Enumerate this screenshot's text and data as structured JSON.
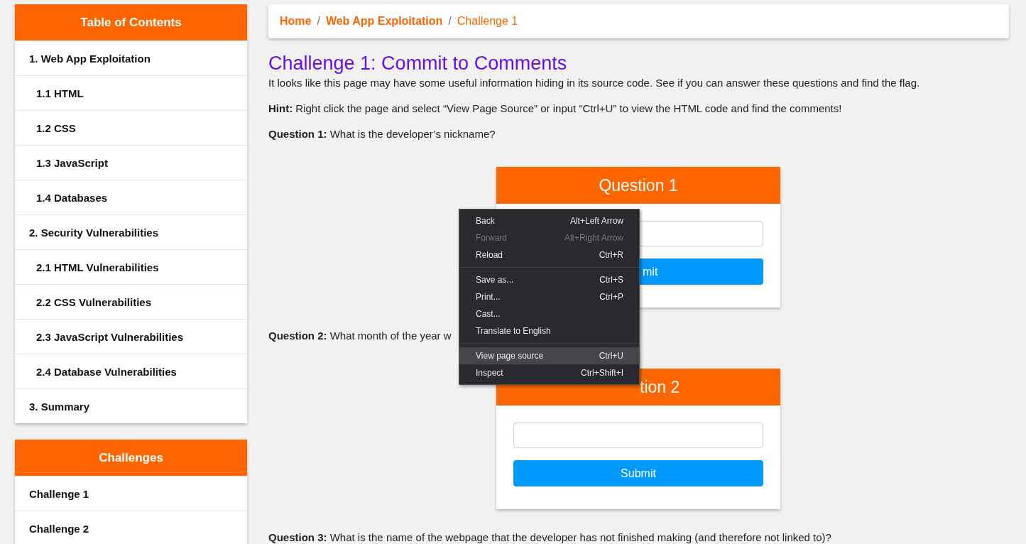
{
  "toc": {
    "title": "Table of Contents",
    "items": [
      {
        "label": "1. Web App Exploitation",
        "children": [
          {
            "label": "1.1 HTML"
          },
          {
            "label": "1.2 CSS"
          },
          {
            "label": "1.3 JavaScript"
          },
          {
            "label": "1.4 Databases"
          }
        ]
      },
      {
        "label": "2. Security Vulnerabilities",
        "children": [
          {
            "label": "2.1 HTML Vulnerabilities"
          },
          {
            "label": "2.2 CSS Vulnerabilities"
          },
          {
            "label": "2.3 JavaScript Vulnerabilities"
          },
          {
            "label": "2.4 Database Vulnerabilities"
          }
        ]
      },
      {
        "label": "3. Summary"
      }
    ]
  },
  "challenges": {
    "title": "Challenges",
    "items": [
      {
        "label": "Challenge 1"
      },
      {
        "label": "Challenge 2"
      }
    ]
  },
  "breadcrumb": [
    {
      "label": "Home",
      "kind": "link"
    },
    {
      "label": "/",
      "kind": "separator"
    },
    {
      "label": "Web App Exploitation",
      "kind": "link"
    },
    {
      "label": "/",
      "kind": "separator"
    },
    {
      "label": "Challenge 1",
      "kind": "current"
    }
  ],
  "heading": "Challenge 1: Commit to Comments",
  "intro": "It looks like this page may have some useful information hiding in its source code. See if you can answer these questions and find the flag.",
  "hint": "**Hint:** Right click the page and select “View Page Source” or input “Ctrl+U” to view the HTML code and find the comments!",
  "questions": [
    {
      "prompt": "**Question 1:** What is the developer’s nickname?",
      "card": {
        "title": "Question 1",
        "title_cut_left": false,
        "button": "mit",
        "button_cut_left": true
      }
    },
    {
      "prompt": "**Question 2:** What month of the year w",
      "card": {
        "title": "tion 2",
        "title_cut_left": true,
        "button": "Submit",
        "button_cut_left": false
      }
    },
    {
      "prompt": "**Question 3:** What is the name of the webpage that the developer has not finished making (and therefore not linked to)?"
    }
  ],
  "context_menu": [
    {
      "kind": "item",
      "label": "Back",
      "shortcut": "Alt+Left Arrow",
      "disabled": false,
      "selected": false
    },
    {
      "kind": "item",
      "label": "Forward",
      "shortcut": "Alt+Right Arrow",
      "disabled": true,
      "selected": false
    },
    {
      "kind": "item",
      "label": "Reload",
      "shortcut": "Ctrl+R",
      "disabled": false,
      "selected": false
    },
    {
      "kind": "separator"
    },
    {
      "kind": "item",
      "label": "Save as...",
      "shortcut": "Ctrl+S",
      "disabled": false,
      "selected": false
    },
    {
      "kind": "item",
      "label": "Print...",
      "shortcut": "Ctrl+P",
      "disabled": false,
      "selected": false
    },
    {
      "kind": "item",
      "label": "Cast...",
      "disabled": false,
      "selected": false
    },
    {
      "kind": "item",
      "label": "Translate to English",
      "disabled": false,
      "selected": false
    },
    {
      "kind": "separator"
    },
    {
      "kind": "item",
      "label": "View page source",
      "shortcut": "Ctrl+U",
      "disabled": false,
      "selected": true
    },
    {
      "kind": "item",
      "label": "Inspect",
      "shortcut": "Ctrl+Shift+I",
      "disabled": false,
      "selected": false
    }
  ]
}
